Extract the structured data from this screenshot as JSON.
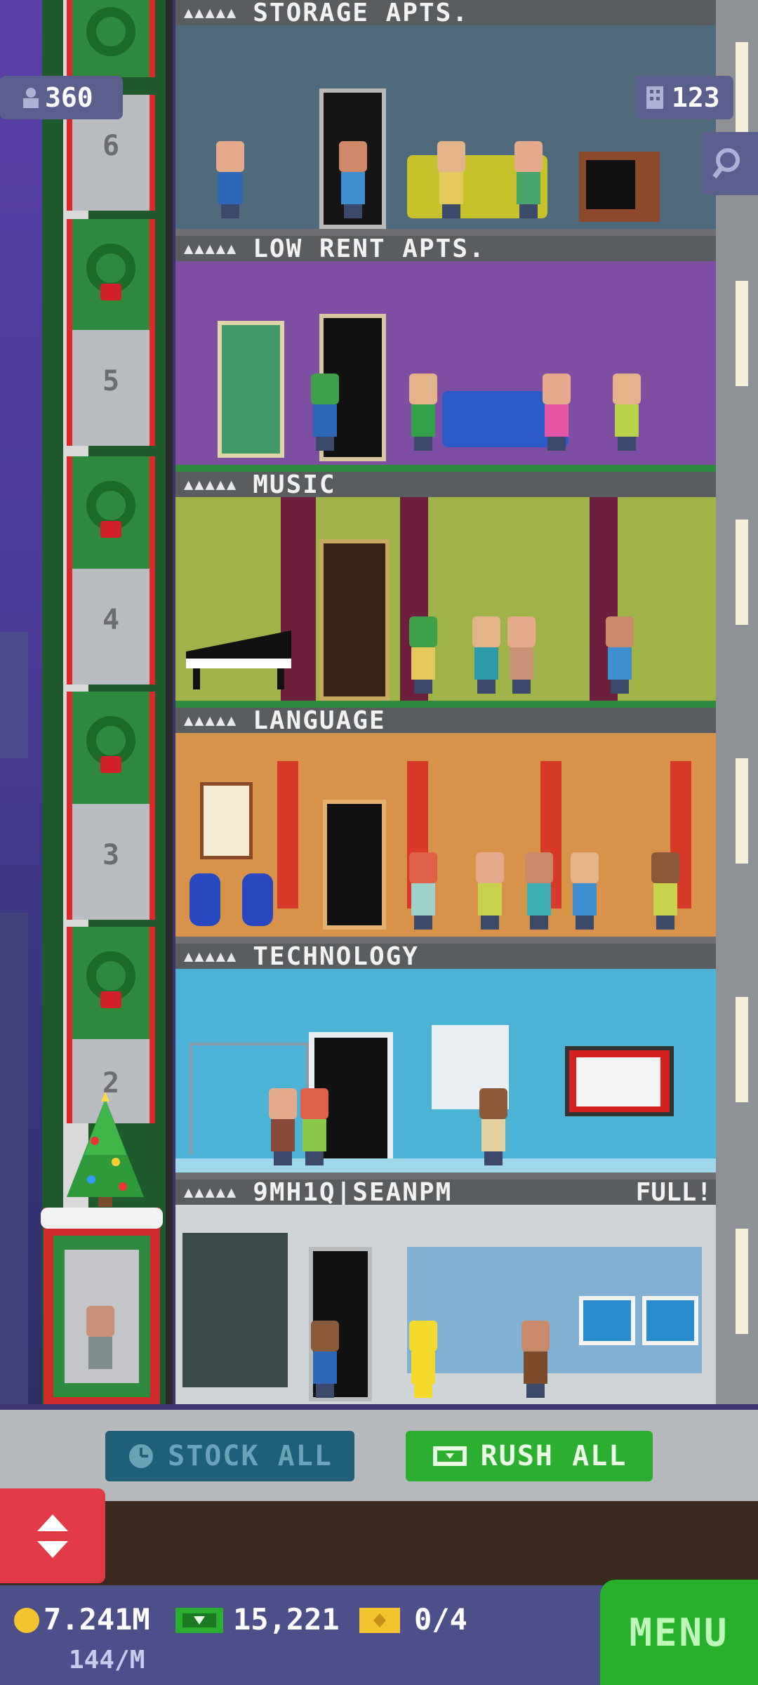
{
  "counters": {
    "population": "360",
    "floors": "123",
    "population_icon": "person-icon",
    "floors_icon": "building-icon",
    "search_icon": "magnifier-icon"
  },
  "elevator": {
    "floor_numbers": [
      "6",
      "5",
      "4",
      "3",
      "2"
    ]
  },
  "floors": [
    {
      "stars": "▲▲▲▲▲",
      "name": "STORAGE APTS.",
      "status": ""
    },
    {
      "stars": "▲▲▲▲▲",
      "name": "LOW RENT APTS.",
      "status": ""
    },
    {
      "stars": "▲▲▲▲▲",
      "name": "MUSIC",
      "status": ""
    },
    {
      "stars": "▲▲▲▲▲",
      "name": "LANGUAGE",
      "status": ""
    },
    {
      "stars": "▲▲▲▲▲",
      "name": "TECHNOLOGY",
      "status": ""
    },
    {
      "stars": "▲▲▲▲▲",
      "name": "9MH1Q|SEANPM",
      "status": "FULL!"
    }
  ],
  "actions": {
    "stock_all": "STOCK ALL",
    "rush_all": "RUSH ALL"
  },
  "status": {
    "coins": "7.241M",
    "coin_rate": "144/M",
    "bux": "15,221",
    "tickets": "0/4",
    "menu": "MENU"
  },
  "colors": {
    "stock_button": "#1f5f78",
    "rush_button": "#2cae31",
    "menu_button": "#27b02c",
    "elevator_toggle": "#e23a45"
  }
}
